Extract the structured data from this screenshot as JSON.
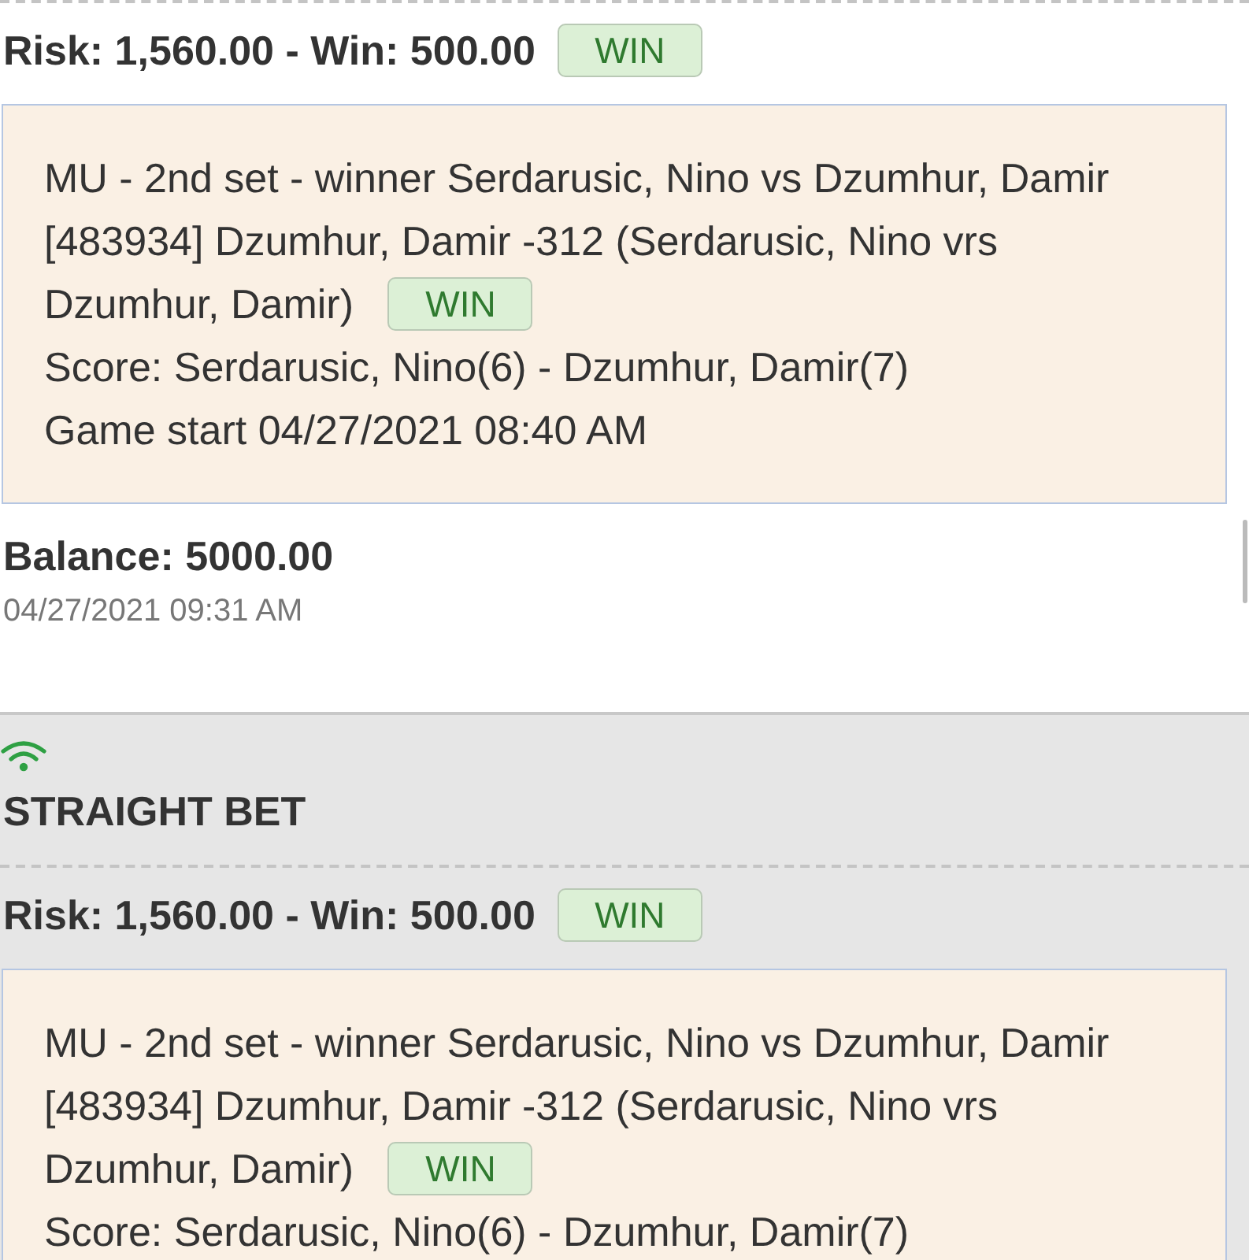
{
  "bets": [
    {
      "selected": false,
      "risk_line": "Risk: 1,560.00 - Win: 500.00",
      "result": "WIN",
      "details": {
        "lines": [
          "MU - 2nd set - winner Serdarusic, Nino vs Dzumhur, Damir",
          "[483934] Dzumhur, Damir -312 (Serdarusic, Nino vrs",
          "Dzumhur, Damir)"
        ],
        "result": "WIN",
        "score": "Score: Serdarusic, Nino(6) - Dzumhur, Damir(7)",
        "game_start": "Game start 04/27/2021 08:40 AM"
      },
      "balance": "Balance: 5000.00",
      "timestamp": "04/27/2021 09:31 AM"
    },
    {
      "selected": true,
      "title": "STRAIGHT BET",
      "risk_line": "Risk: 1,560.00 - Win: 500.00",
      "result": "WIN",
      "details": {
        "lines": [
          "MU - 2nd set - winner Serdarusic, Nino vs Dzumhur, Damir",
          "[483934] Dzumhur, Damir -312 (Serdarusic, Nino vrs",
          "Dzumhur, Damir)"
        ],
        "result": "WIN",
        "score": "Score: Serdarusic, Nino(6) - Dzumhur, Damir(7)"
      }
    }
  ]
}
